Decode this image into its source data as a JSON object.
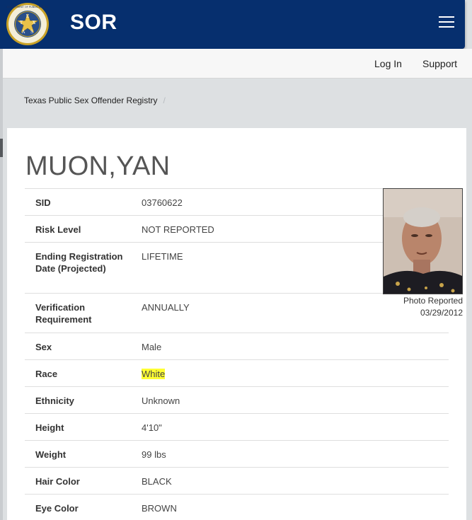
{
  "header": {
    "brand": "SOR",
    "seal": {
      "name": "Texas Department of Public Safety seal",
      "ring_text": "DEPARTMENT OF PUBLIC SAFETY",
      "letters": [
        "T",
        "E",
        "X",
        "A",
        "S"
      ],
      "colors": {
        "ring": "#c9a227",
        "inner": "#2a4f8a",
        "star": "#e8c14a"
      }
    },
    "menu_icon": "hamburger-menu-icon"
  },
  "topbar": {
    "login": "Log In",
    "support": "Support"
  },
  "breadcrumb": {
    "item": "Texas Public Sex Offender Registry",
    "separator": "/"
  },
  "offender": {
    "name": "MUON,YAN",
    "photo": {
      "caption_line1": "Photo Reported",
      "caption_line2": "03/29/2012"
    },
    "fields": [
      {
        "label": "SID",
        "value": "03760622"
      },
      {
        "label": "Risk Level",
        "value": "NOT REPORTED"
      },
      {
        "label": "Ending Registration Date (Projected)",
        "value": "LIFETIME"
      },
      {
        "label": "Verification Requirement",
        "value": "ANNUALLY"
      },
      {
        "label": "Sex",
        "value": "Male"
      },
      {
        "label": "Race",
        "value": "White"
      },
      {
        "label": "Ethnicity",
        "value": "Unknown"
      },
      {
        "label": "Height",
        "value": "4'10\""
      },
      {
        "label": "Weight",
        "value": "99 lbs"
      },
      {
        "label": "Hair Color",
        "value": "BLACK"
      },
      {
        "label": "Eye Color",
        "value": "BROWN"
      }
    ]
  },
  "colors": {
    "navbar": "#062f6e",
    "highlight": "#ffff33",
    "name_text": "#555555"
  }
}
